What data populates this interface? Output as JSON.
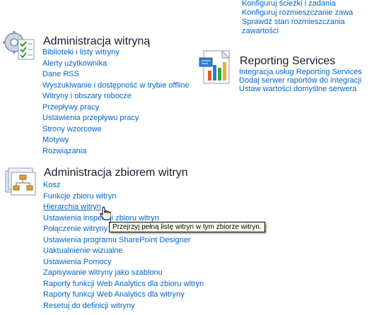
{
  "top_links": [
    "Konfiguruj ścieżki i zadania",
    "Konfiguruj rozmieszczanie zawa",
    "Sprawdź stan rozmieszczania",
    "zawartości"
  ],
  "site_admin": {
    "title": "Administracja witryną",
    "icon": "site-settings-icon",
    "links": [
      "Biblioteki i listy witryny",
      "Alerty użytkownika",
      "Dane RSS",
      "Wyszukiwanie i dostępność w trybie offline",
      "Witryny i obszary robocze",
      "Przepływy pracy",
      "Ustawienia przepływu pracy",
      "Strony wzorcowe",
      "Motywy",
      "Rozwiązania"
    ]
  },
  "reporting": {
    "title": "Reporting Services",
    "icon": "reporting-chart-icon",
    "links": [
      "Integracja usług Reporting Services",
      "Dodaj serwer raportów do integracji",
      "Ustaw wartości domyślne serwera"
    ]
  },
  "collection_admin": {
    "title": "Administracja zbiorem witryn",
    "icon": "site-hierarchy-icon",
    "links": [
      "Kosz",
      "Funkcje zbioru witryn",
      "Hierarchia witryn",
      "Ustawienia inspekcji zbioru witryn",
      "Połączenie witryny",
      "Ustawienia programu SharePoint Designer",
      "Uaktualnienie wizualne",
      "Ustawienia Pomocy",
      "Zapisywanie witryny jako szablonu",
      "Raporty funkcji Web Analytics dla zbioru witryn",
      "Raporty funkcji Web Analytics dla witryny",
      "Resetuj do definicji witryny"
    ]
  },
  "tooltip": "Przejrzyj pełną listę witryn w tym zbiorze witryn.",
  "colors": {
    "link": "#0066cc",
    "heading": "#1a1a2e",
    "tooltip_bg": "#fffff0"
  }
}
